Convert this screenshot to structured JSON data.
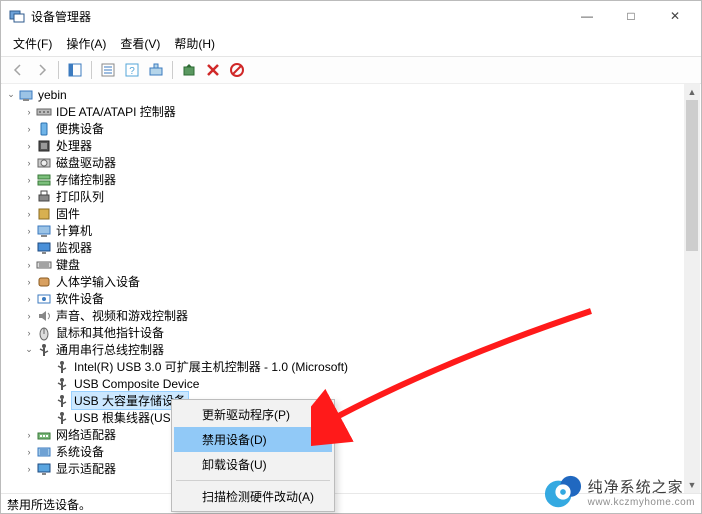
{
  "window": {
    "title": "设备管理器"
  },
  "window_controls": {
    "minimize": "—",
    "maximize": "□",
    "close": "✕"
  },
  "menu": {
    "file": "文件(F)",
    "action": "操作(A)",
    "view": "查看(V)",
    "help": "帮助(H)"
  },
  "statusbar": {
    "text": "禁用所选设备。"
  },
  "root": {
    "name": "yebin"
  },
  "categories": [
    {
      "label": "IDE ATA/ATAPI 控制器",
      "icon": "ide"
    },
    {
      "label": "便携设备",
      "icon": "portable"
    },
    {
      "label": "处理器",
      "icon": "cpu"
    },
    {
      "label": "磁盘驱动器",
      "icon": "disk"
    },
    {
      "label": "存储控制器",
      "icon": "storage"
    },
    {
      "label": "打印队列",
      "icon": "printer"
    },
    {
      "label": "固件",
      "icon": "firmware"
    },
    {
      "label": "计算机",
      "icon": "computer"
    },
    {
      "label": "监视器",
      "icon": "monitor"
    },
    {
      "label": "键盘",
      "icon": "keyboard"
    },
    {
      "label": "人体学输入设备",
      "icon": "hid"
    },
    {
      "label": "软件设备",
      "icon": "software"
    },
    {
      "label": "声音、视频和游戏控制器",
      "icon": "sound"
    },
    {
      "label": "鼠标和其他指针设备",
      "icon": "mouse"
    },
    {
      "label": "通用串行总线控制器",
      "icon": "usb",
      "expanded": true,
      "children": [
        {
          "label": "Intel(R) USB 3.0 可扩展主机控制器 - 1.0 (Microsoft)",
          "icon": "usb"
        },
        {
          "label": "USB Composite Device",
          "icon": "usb"
        },
        {
          "label": "USB 大容量存储设备",
          "icon": "usb",
          "selected": true
        },
        {
          "label": "USB 根集线器(US",
          "icon": "usb"
        }
      ]
    },
    {
      "label": "网络适配器",
      "icon": "network"
    },
    {
      "label": "系统设备",
      "icon": "system"
    },
    {
      "label": "显示适配器",
      "icon": "display"
    }
  ],
  "context_menu": {
    "update_driver": "更新驱动程序(P)",
    "disable_device": "禁用设备(D)",
    "uninstall_device": "卸载设备(U)",
    "scan_hardware": "扫描检测硬件改动(A)"
  },
  "watermark": {
    "text": "纯净系统之家",
    "url": "www.kczmyhome.com"
  }
}
